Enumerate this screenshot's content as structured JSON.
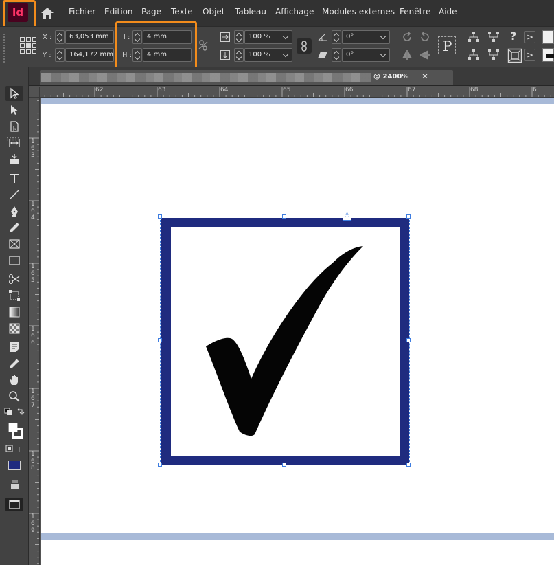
{
  "app": {
    "logo_text": "Id"
  },
  "menu": [
    "Fichier",
    "Edition",
    "Page",
    "Texte",
    "Objet",
    "Tableau",
    "Affichage",
    "Modules externes",
    "Fenêtre",
    "Aide"
  ],
  "control_panel": {
    "x_label": "X :",
    "x_value": "63,053 mm",
    "y_label": "Y :",
    "y_value": "164,172 mm",
    "w_label": "l :",
    "w_value": "4 mm",
    "h_label": "H :",
    "h_value": "4 mm",
    "scale_x_value": "100 %",
    "scale_y_value": "100 %",
    "rotation_value": "0°",
    "shear_value": "0°",
    "help_glyph": "?",
    "more_glyph": ">"
  },
  "document_tab": {
    "zoom": "@ 2400%",
    "close_glyph": "✕"
  },
  "ruler": {
    "h_numbers": [
      "62",
      "63",
      "64",
      "65",
      "66",
      "67",
      "68",
      "6"
    ],
    "v_groups": [
      [
        "1",
        "6",
        "3"
      ],
      [
        "1",
        "6",
        "4"
      ],
      [
        "1",
        "6",
        "5"
      ],
      [
        "1",
        "6",
        "6"
      ],
      [
        "1",
        "6",
        "7"
      ],
      [
        "1",
        "6",
        "8"
      ],
      [
        "1",
        "6",
        "9"
      ]
    ]
  },
  "colors": {
    "accent_highlight": "#f28c1c",
    "frame_stroke": "#1f2b7f",
    "selection": "#3e7de0",
    "margin_guide": "#a8bad8",
    "logo_bg": "#49021f",
    "logo_fg": "#ff3366"
  },
  "icons": [
    "home-icon",
    "reference-point-icon",
    "constrain-proportions-icon",
    "selection-tool-icon",
    "direct-selection-tool-icon",
    "page-tool-icon",
    "gap-tool-icon",
    "content-collector-icon",
    "type-tool-icon",
    "line-tool-icon",
    "pen-tool-icon",
    "pencil-tool-icon",
    "rectangle-frame-tool-icon",
    "rectangle-tool-icon",
    "scissors-tool-icon",
    "free-transform-tool-icon",
    "gradient-swatch-tool-icon",
    "gradient-feather-tool-icon",
    "note-tool-icon",
    "eyedropper-tool-icon",
    "hand-tool-icon",
    "zoom-tool-icon",
    "checkmark-icon",
    "anchor-icon"
  ]
}
